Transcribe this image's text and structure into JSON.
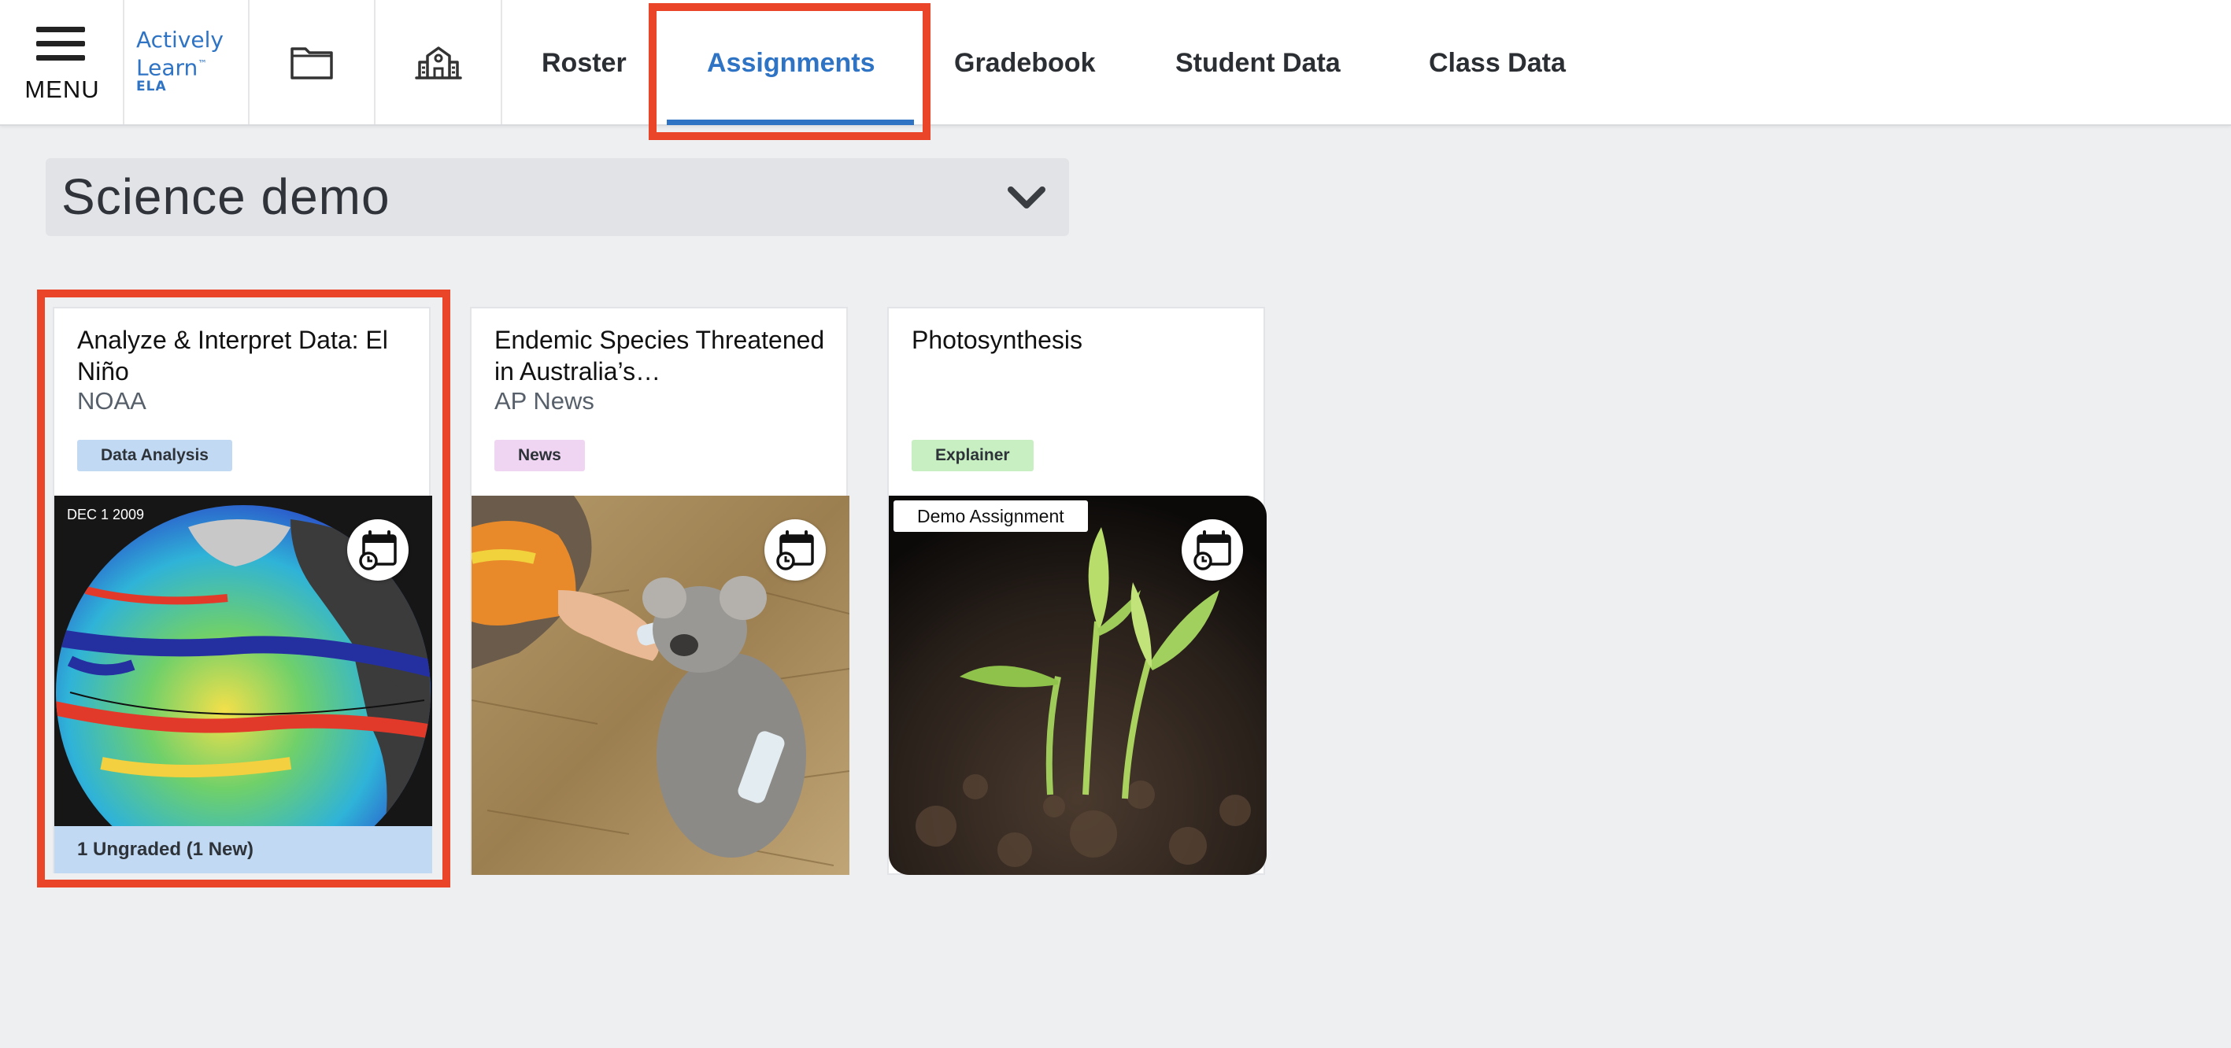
{
  "nav": {
    "menu_label": "MENU",
    "logo_line1": "Actively",
    "logo_line2": "Learn",
    "logo_tm": "™",
    "logo_sub": "ELA",
    "tabs": [
      {
        "label": "Roster"
      },
      {
        "label": "Assignments"
      },
      {
        "label": "Gradebook"
      },
      {
        "label": "Student Data"
      },
      {
        "label": "Class Data"
      }
    ],
    "active_tab": "Assignments",
    "accent_color": "#2e73c4",
    "highlight_color": "#ea4429"
  },
  "class_selector": {
    "value": "Science demo"
  },
  "cards": [
    {
      "title": "Analyze & Interpret Data: El Niño",
      "source": "NOAA",
      "tag": "Data Analysis",
      "image_caption": "DEC  1 2009",
      "footer": "1 Ungraded (1 New)",
      "icon": "calendar-clock-icon"
    },
    {
      "title": "Endemic Species Threatened in Australia’s…",
      "source": "AP News",
      "tag": "News",
      "icon": "calendar-clock-icon"
    },
    {
      "title": "Photosynthesis",
      "source": "",
      "tag": "Explainer",
      "overlay_label": "Demo Assignment",
      "icon": "calendar-clock-icon"
    }
  ]
}
